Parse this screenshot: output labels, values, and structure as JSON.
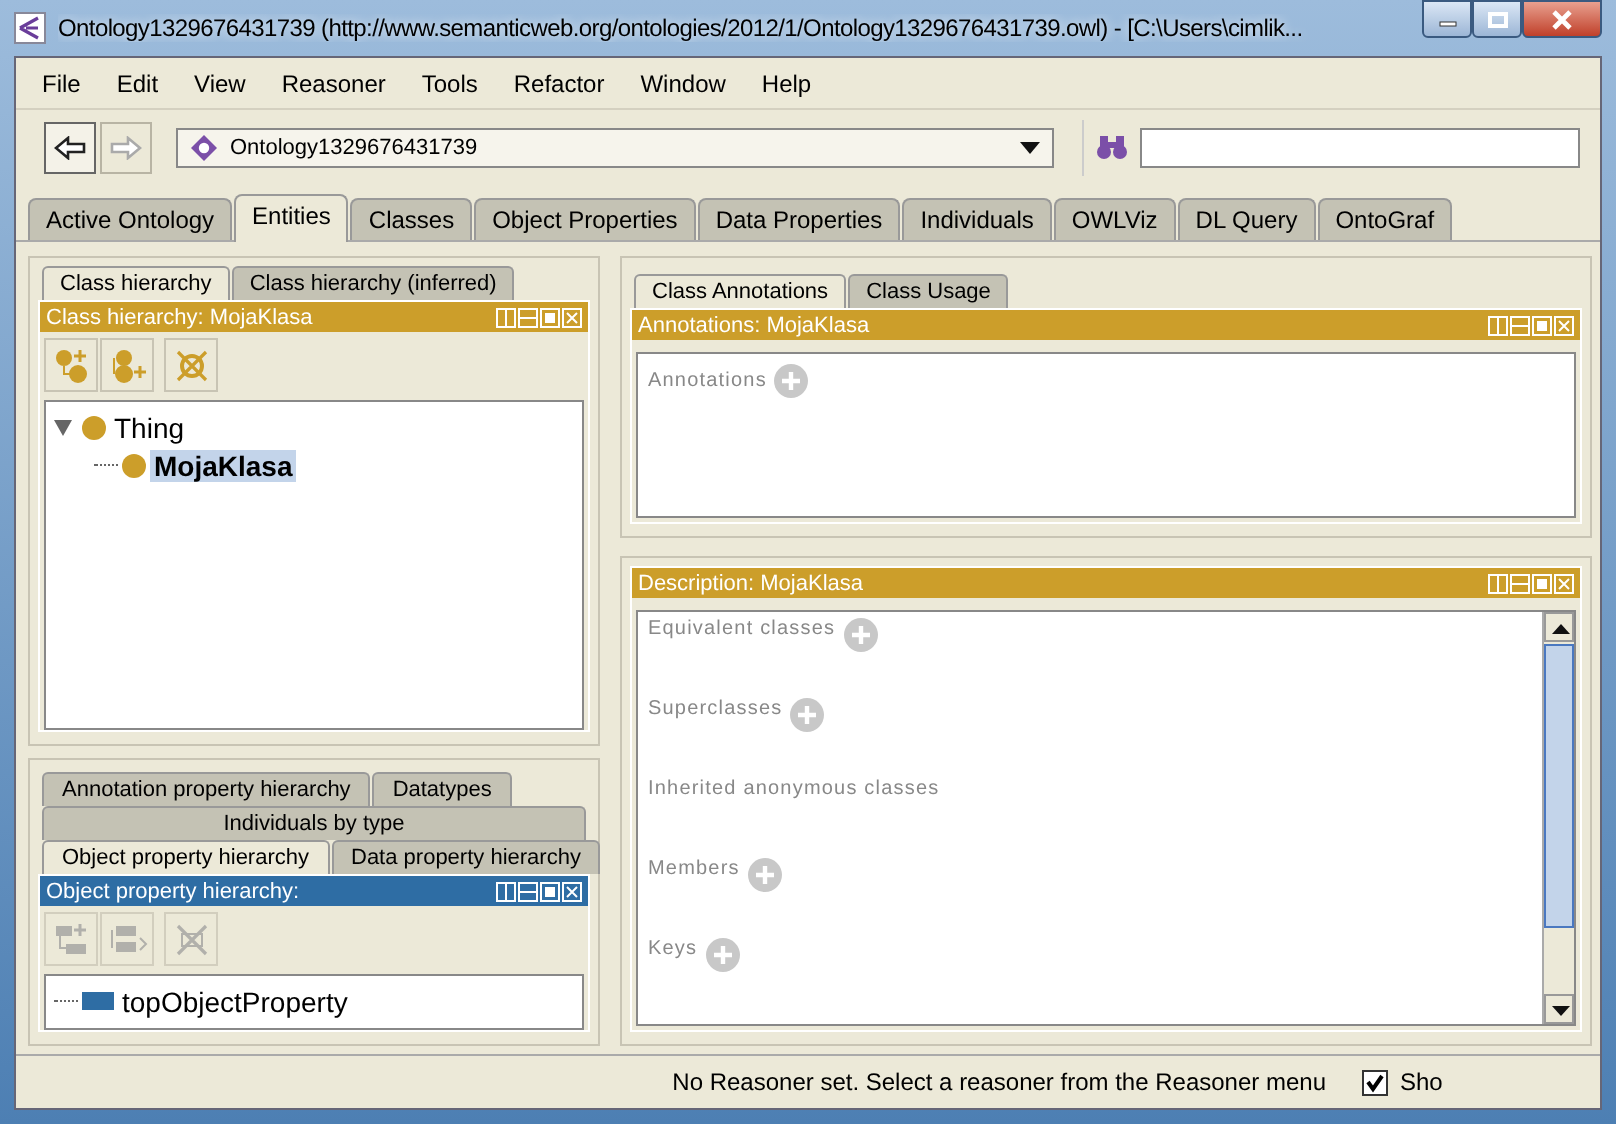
{
  "window": {
    "title": "Ontology1329676431739 (http://www.semanticweb.org/ontologies/2012/1/Ontology1329676431739.owl) - [C:\\Users\\cimlik..."
  },
  "menu": [
    "File",
    "Edit",
    "View",
    "Reasoner",
    "Tools",
    "Refactor",
    "Window",
    "Help"
  ],
  "navigation": {
    "back_enabled": true,
    "forward_enabled": false
  },
  "ontology_selector": {
    "value": "Ontology1329676431739"
  },
  "tabs": [
    {
      "label": "Active Ontology",
      "selected": false
    },
    {
      "label": "Entities",
      "selected": true
    },
    {
      "label": "Classes",
      "selected": false
    },
    {
      "label": "Object Properties",
      "selected": false
    },
    {
      "label": "Data Properties",
      "selected": false
    },
    {
      "label": "Individuals",
      "selected": false
    },
    {
      "label": "OWLViz",
      "selected": false
    },
    {
      "label": "DL Query",
      "selected": false
    },
    {
      "label": "OntoGraf",
      "selected": false
    }
  ],
  "class_panel": {
    "tabs": [
      {
        "label": "Class hierarchy",
        "selected": true
      },
      {
        "label": "Class hierarchy (inferred)",
        "selected": false
      }
    ],
    "title": "Class hierarchy: MojaKlasa",
    "toolbar_enabled": true,
    "tree": [
      {
        "label": "Thing",
        "expanded": true,
        "selected": false,
        "children": [
          {
            "label": "MojaKlasa",
            "selected": true
          }
        ]
      }
    ]
  },
  "property_panel": {
    "tab_rows": [
      {
        "tabs": [
          {
            "label": "Annotation property hierarchy",
            "selected": false
          },
          {
            "label": "Datatypes",
            "selected": false
          }
        ]
      },
      {
        "tabs": [
          {
            "label": "Individuals by type",
            "selected": false
          }
        ]
      },
      {
        "tabs": [
          {
            "label": "Object property hierarchy",
            "selected": true
          },
          {
            "label": "Data property hierarchy",
            "selected": false
          }
        ]
      }
    ],
    "title": "Object property hierarchy:",
    "toolbar_enabled": false,
    "tree": [
      {
        "label": "topObjectProperty",
        "selected": false
      }
    ]
  },
  "annotations_panel": {
    "tabs": [
      {
        "label": "Class Annotations",
        "selected": true
      },
      {
        "label": "Class Usage",
        "selected": false
      }
    ],
    "title": "Annotations: MojaKlasa",
    "sections": [
      "Annotations"
    ]
  },
  "description_panel": {
    "title": "Description: MojaKlasa",
    "sections": [
      "Equivalent classes",
      "Superclasses",
      "Inherited anonymous classes",
      "Members",
      "Keys"
    ],
    "addable": [
      true,
      true,
      false,
      true,
      true
    ]
  },
  "status_bar": {
    "message": "No Reasoner set. Select a reasoner from the Reasoner menu",
    "checkbox": {
      "label": "Sho",
      "checked": true
    }
  }
}
